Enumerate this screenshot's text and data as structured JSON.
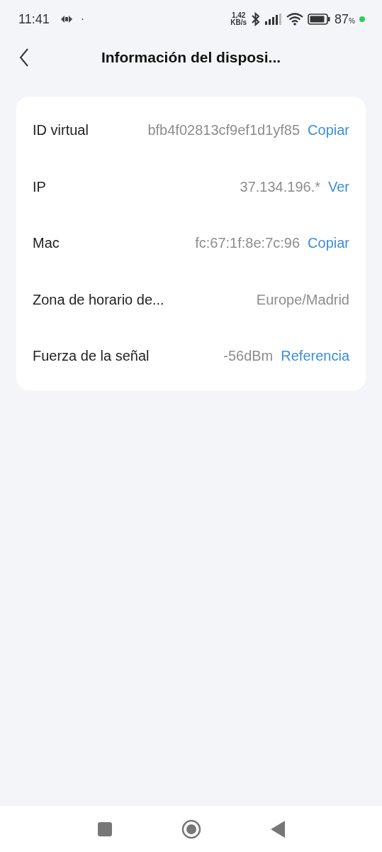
{
  "status_bar": {
    "time": "11:41",
    "separator": "·",
    "speed": "1,42",
    "speed_unit": "KB/s",
    "battery": "87",
    "battery_unit": "%"
  },
  "header": {
    "title": "Información del disposi..."
  },
  "info_rows": [
    {
      "label": "ID virtual",
      "value": "bfb4f02813cf9ef1d1yf85",
      "action": "Copiar"
    },
    {
      "label": "IP",
      "value": "37.134.196.*",
      "action": "Ver"
    },
    {
      "label": "Mac",
      "value": "fc:67:1f:8e:7c:96",
      "action": "Copiar"
    },
    {
      "label": "Zona de horario de...",
      "value": "Europe/Madrid"
    },
    {
      "label": "Fuerza de la señal",
      "value": "-56dBm",
      "action": "Referencia"
    }
  ]
}
